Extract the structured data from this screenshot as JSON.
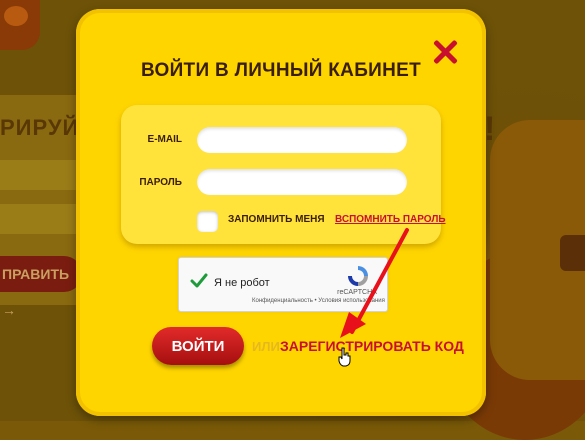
{
  "background": {
    "left_heading": "РИРУЙ КО",
    "left_button": "ПРАВИТЬ →",
    "right_fragment": "!"
  },
  "modal": {
    "title": "ВОЙТИ В ЛИЧНЫЙ КАБИНЕТ",
    "email_label": "E-MAIL",
    "email_value": "",
    "password_label": "ПАРОЛЬ",
    "password_value": "",
    "remember_label": "ЗАПОМНИТЬ МЕНЯ",
    "remember_checked": false,
    "forgot_link": "ВСПОМНИТЬ ПАРОЛЬ",
    "login_button": "ВОЙТИ",
    "or_text": "ИЛИ",
    "register_link": "ЗАРЕГИСТРИРОВАТЬ КОД"
  },
  "captcha": {
    "label": "Я не робот",
    "brand": "reCAPTCHA",
    "links": "Конфиденциальность • Условия использования",
    "checked": true
  },
  "colors": {
    "modal_bg": "#ffd500",
    "accent_red": "#c8102e",
    "text_dark": "#3a1f08"
  },
  "icons": [
    "close-icon",
    "checkmark-icon",
    "recaptcha-icon",
    "arrow-annotation",
    "hand-cursor-icon"
  ]
}
